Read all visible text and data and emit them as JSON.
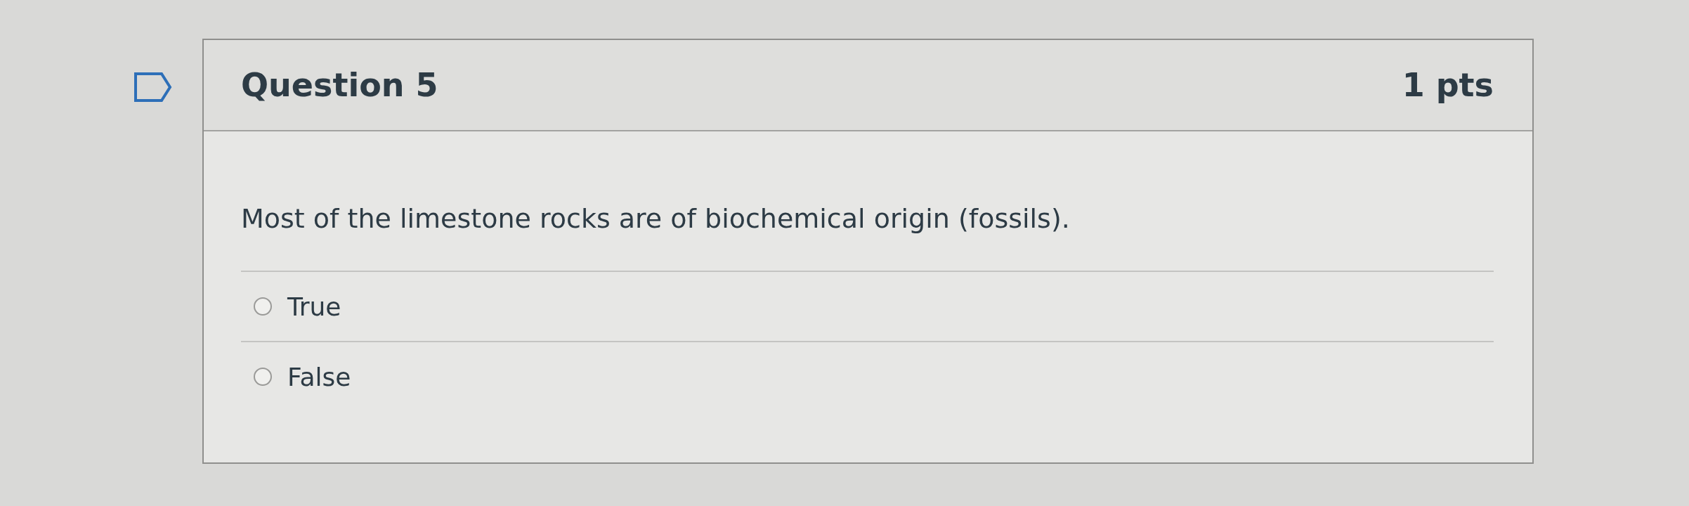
{
  "question": {
    "title": "Question 5",
    "points": "1 pts",
    "text": "Most of the limestone rocks are of biochemical origin (fossils).",
    "answers": [
      {
        "label": "True",
        "selected": false
      },
      {
        "label": "False",
        "selected": false
      }
    ]
  }
}
